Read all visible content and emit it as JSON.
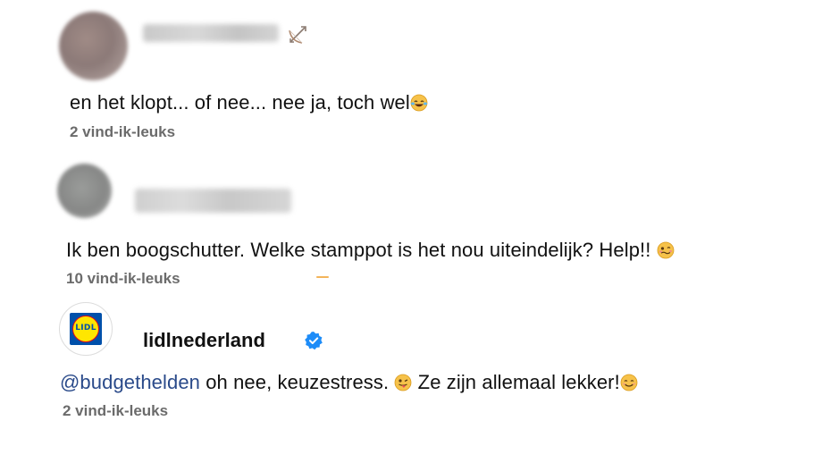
{
  "comments": [
    {
      "text": "en het klopt... of nee... nee ja, toch wel",
      "likes": "2 vind-ik-leuks"
    },
    {
      "text": "Ik ben boogschutter. Welke stamppot is het nou uiteindelijk? Help!!",
      "likes": "10 vind-ik-leuks"
    },
    {
      "username": "lidlnederland",
      "logo_text": "LIDL",
      "mention": "@budgethelden",
      "text_part1": " oh nee, keuzestress. ",
      "text_part2": " Ze zijn allemaal lekker!",
      "likes": "2 vind-ik-leuks"
    }
  ],
  "icons": {
    "bow": "bow-and-arrow-icon",
    "laugh": "tears-of-joy-emoji-icon",
    "woozy": "woozy-face-emoji-icon",
    "wink_tongue": "winking-tongue-emoji-icon",
    "smile": "smiling-face-emoji-icon",
    "verified": "verified-badge-icon"
  },
  "colors": {
    "likes_text": "#6b6b6b",
    "mention": "#2a4a8a",
    "verified": "#1d8cf8",
    "lidl_blue": "#0050aa",
    "lidl_yellow": "#ffe600",
    "lidl_red": "#e60a14"
  }
}
